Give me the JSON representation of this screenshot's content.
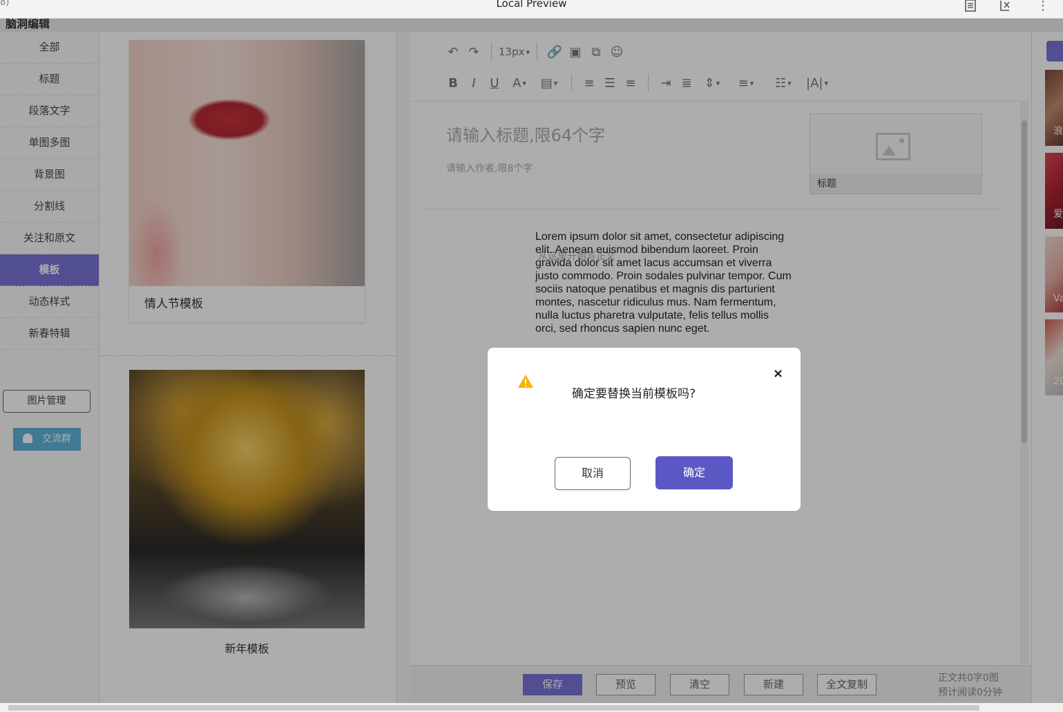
{
  "window": {
    "title": "Local Preview",
    "left_fragment": "8)"
  },
  "app": {
    "header_title": "脑洞编辑"
  },
  "sidebar": {
    "items": [
      {
        "label": "全部"
      },
      {
        "label": "标题"
      },
      {
        "label": "段落文字"
      },
      {
        "label": "单图多图"
      },
      {
        "label": "背景图"
      },
      {
        "label": "分割线"
      },
      {
        "label": "关注和原文"
      },
      {
        "label": "模板",
        "active": true
      },
      {
        "label": "动态样式"
      },
      {
        "label": "新春特辑"
      }
    ],
    "image_manage": "图片管理",
    "group": "交流群"
  },
  "templates": [
    {
      "label": "情人节模板"
    },
    {
      "label": "新年模板"
    }
  ],
  "editor": {
    "font_size": "13px",
    "title_placeholder": "请输入标题,限64个字",
    "author_placeholder": "请输入作者,限8个字",
    "cover_label": "标题",
    "body_placeholder": "从这里开始写正文",
    "body_text": "Lorem ipsum dolor sit amet, consectetur adipiscing elit. Aenean euismod bibendum laoreet. Proin gravida dolor sit amet lacus accumsan et viverra justo commodo. Proin sodales pulvinar tempor. Cum sociis natoque penatibus et magnis dis parturient montes, nascetur ridiculus mus. Nam fermentum, nulla luctus pharetra vulputate, felis tellus mollis orci, sed rhoncus sapien nunc eget."
  },
  "bottombar": {
    "save": "保存",
    "preview": "预览",
    "clear": "清空",
    "new": "新建",
    "copy_all": "全文复制",
    "word_count": "正文共0字0图",
    "read_time": "预计阅读0分钟"
  },
  "right_panel": {
    "thumb_texts": [
      "浪",
      "爱",
      "Va",
      "20"
    ]
  },
  "dialog": {
    "message": "确定要替换当前模板吗?",
    "cancel": "取消",
    "confirm": "确定",
    "close_symbol": "×"
  },
  "colors": {
    "accent": "#7a73d8",
    "confirm": "#5b58c6",
    "warning": "#f5b400"
  }
}
